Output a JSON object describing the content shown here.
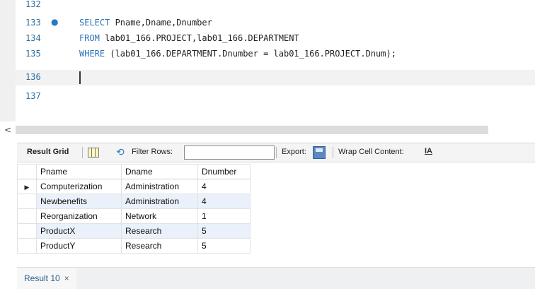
{
  "editor": {
    "lines": [
      {
        "num": "132",
        "text": ""
      },
      {
        "num": "133",
        "kw": "SELECT",
        "rest": " Pname,Dname,Dnumber",
        "dot": "●"
      },
      {
        "num": "134",
        "kw": "FROM",
        "rest": " lab01_166.PROJECT,lab01_166.DEPARTMENT"
      },
      {
        "num": "135",
        "kw": "WHERE",
        "rest": " (lab01_166.DEPARTMENT.Dnumber = lab01_166.PROJECT.Dnum);"
      },
      {
        "num": "136",
        "text": ""
      },
      {
        "num": "137",
        "text": ""
      }
    ]
  },
  "scroll": {
    "left_arrow": "<"
  },
  "toolbar": {
    "result_grid": "Result Grid",
    "filter_rows": "Filter Rows:",
    "filter_value": "",
    "export": "Export:",
    "wrap": "Wrap Cell Content:",
    "wrap_icon": "IA"
  },
  "table": {
    "headers": [
      "Pname",
      "Dname",
      "Dnumber"
    ],
    "rows": [
      [
        "Computerization",
        "Administration",
        "4"
      ],
      [
        "Newbenefits",
        "Administration",
        "4"
      ],
      [
        "Reorganization",
        "Network",
        "1"
      ],
      [
        "ProductX",
        "Research",
        "5"
      ],
      [
        "ProductY",
        "Research",
        "5"
      ]
    ],
    "pointer": "▶"
  },
  "tabs": {
    "result": "Result 10",
    "close": "×"
  },
  "colors": {
    "keyword": "#2c73b8",
    "line_number": "#2b6f9e",
    "alt_row": "#eaf1fb"
  }
}
